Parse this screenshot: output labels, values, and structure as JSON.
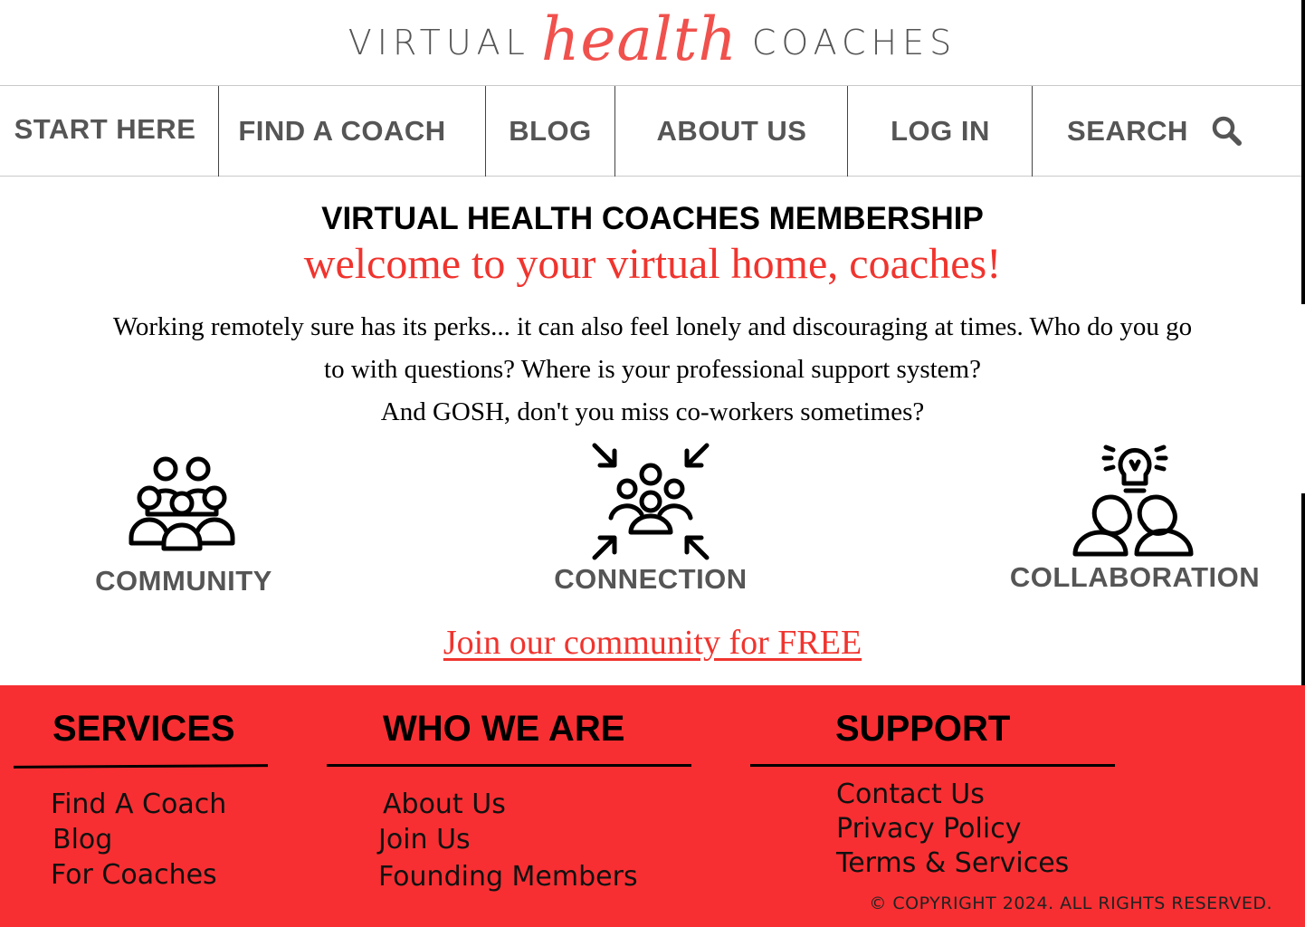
{
  "logo": {
    "word_left": "VIRTUAL",
    "word_script": "health",
    "word_right": "COACHES"
  },
  "nav": {
    "start_here": "START HERE",
    "find_coach": "FIND  A COACH",
    "blog": "BLOG",
    "about_us": "ABOUT US",
    "log_in": "LOG IN",
    "search": "SEARCH",
    "search_icon": "magnifier-icon"
  },
  "main": {
    "title": "VIRTUAL HEALTH COACHES MEMBERSHIP",
    "welcome": "welcome to your virtual home, coaches!",
    "intro_line1": "Working remotely sure has its perks... it can also feel lonely and discouraging at times. Who do you go",
    "intro_line2": "to with questions? Where is your professional support system?",
    "intro_line3": "And GOSH, don't you miss co-workers sometimes?",
    "features": [
      {
        "label": "COMMUNITY",
        "icon": "group-of-people-icon"
      },
      {
        "label": "CONNECTION",
        "icon": "people-converging-arrows-icon"
      },
      {
        "label": "COLLABORATION",
        "icon": "two-people-lightbulb-icon"
      }
    ],
    "join_link": "Join our community for FREE"
  },
  "footer": {
    "services": {
      "heading": "SERVICES",
      "links": [
        "Find A Coach",
        "Blog",
        "For Coaches"
      ]
    },
    "who_we_are": {
      "heading": "WHO WE ARE",
      "links": [
        "About Us",
        "Join Us",
        "Founding Members"
      ]
    },
    "support": {
      "heading": "SUPPORT",
      "links": [
        "Contact Us",
        "Privacy Policy",
        "Terms & Services"
      ]
    },
    "copyright": "© COPYRIGHT 2024. ALL RIGHTS RESERVED."
  },
  "colors": {
    "brand_red": "#f72f32",
    "accent_red": "#f0342e",
    "nav_gray": "#555555"
  }
}
